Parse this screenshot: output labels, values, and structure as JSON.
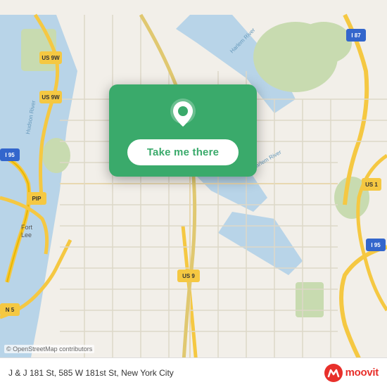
{
  "map": {
    "attribution": "© OpenStreetMap contributors",
    "location": "J & J 181 St, 585 W 181st St, New York City"
  },
  "card": {
    "button_label": "Take me there"
  },
  "branding": {
    "name": "moovit"
  }
}
